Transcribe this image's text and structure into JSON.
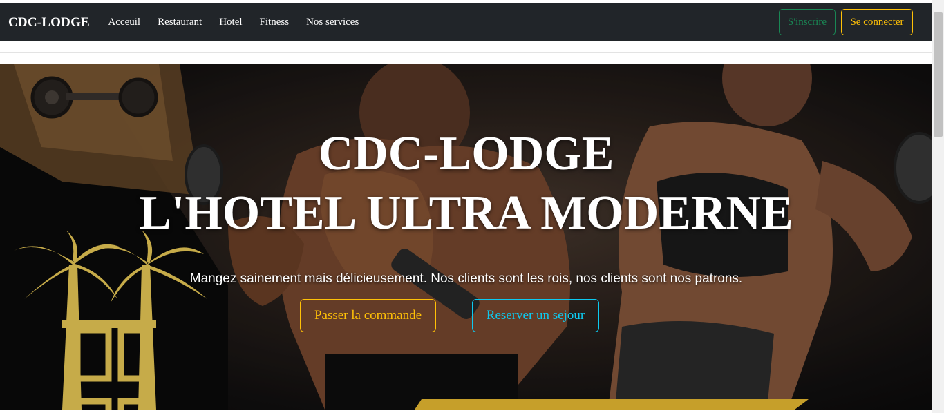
{
  "navbar": {
    "brand": "CDC-LODGE",
    "links": [
      "Acceuil",
      "Restaurant",
      "Hotel",
      "Fitness",
      "Nos services"
    ],
    "signup_label": "S'inscrire",
    "login_label": "Se connecter"
  },
  "hero": {
    "title_line1": "CDC-LODGE",
    "title_line2": "L'HOTEL ULTRA MODERNE",
    "tagline": "Mangez sainement mais délicieusement. Nos clients sont les rois, nos clients sont nos patrons.",
    "order_button": "Passer la commande",
    "reserve_button": "Reserver un sejour"
  },
  "colors": {
    "navbar_bg": "#212529",
    "success": "#198754",
    "warning": "#ffc107",
    "info": "#0dcaf0",
    "logo_yellow": "#f2d15a"
  }
}
